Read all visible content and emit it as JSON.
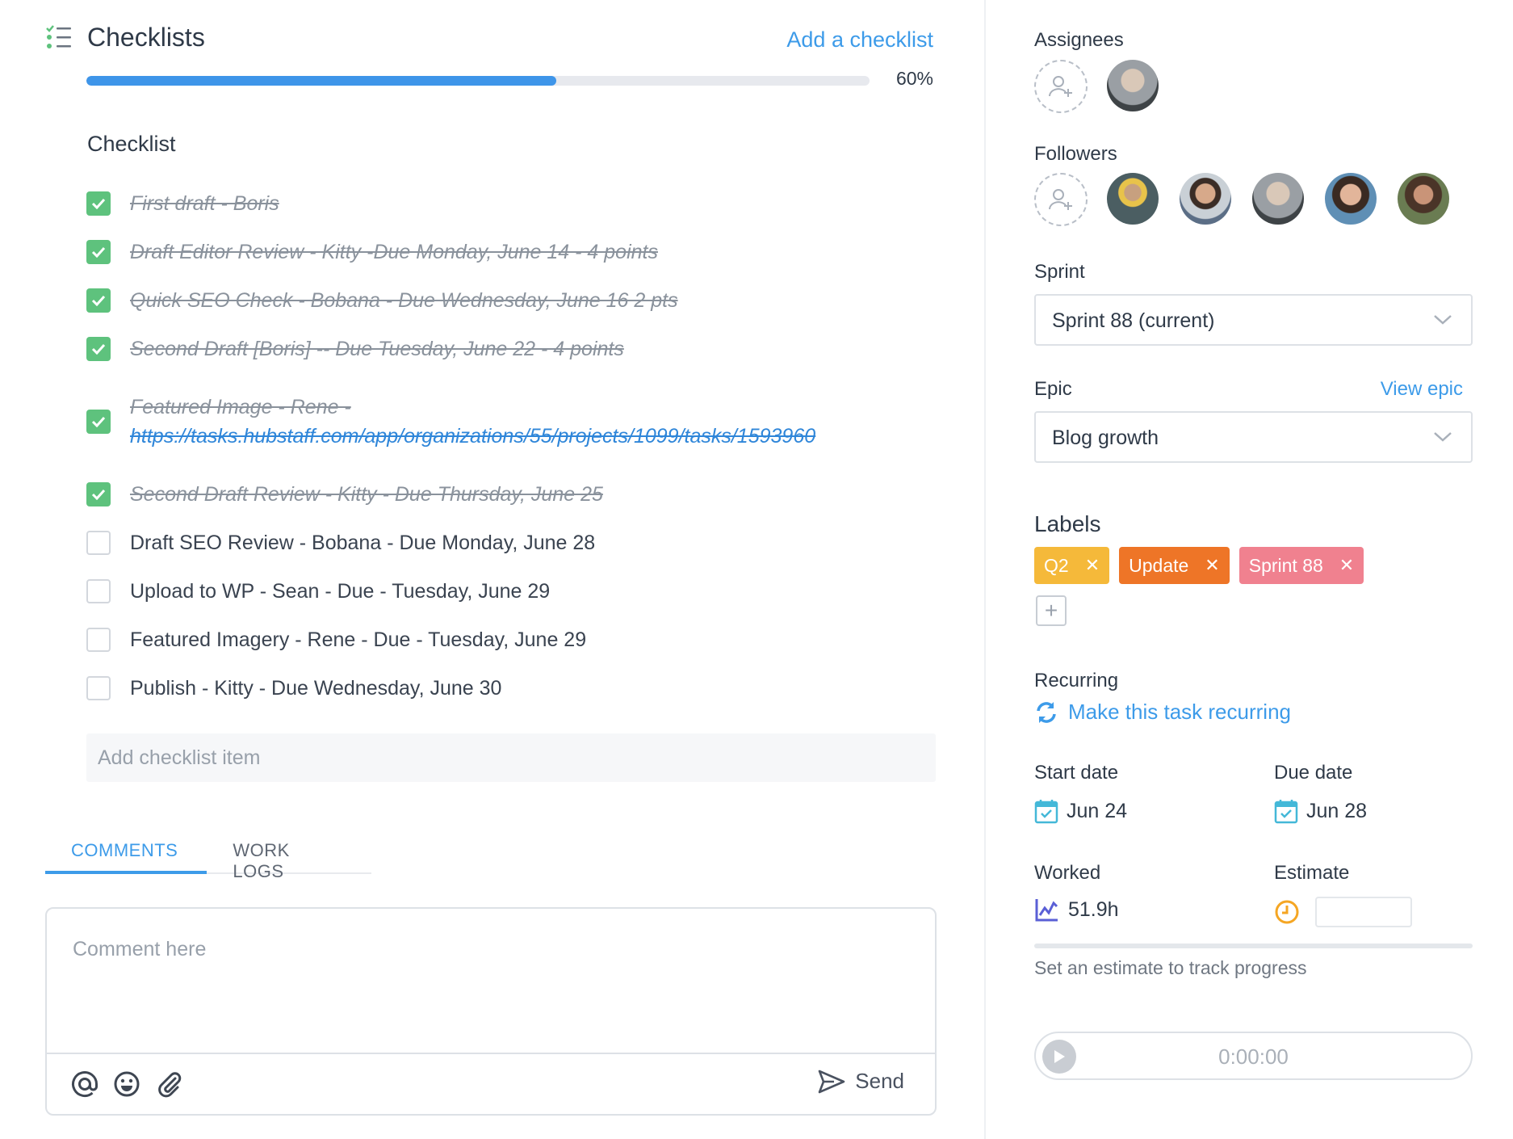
{
  "checklists": {
    "title": "Checklists",
    "add_label": "Add a checklist",
    "progress": 0.6,
    "progress_text": "60%",
    "checklist_title": "Checklist",
    "items": [
      {
        "text": "First draft - Boris",
        "done": true
      },
      {
        "text": "Draft Editor Review - Kitty -Due Monday, June 14 - 4 points",
        "done": true
      },
      {
        "text": "Quick SEO Check - Bobana - Due Wednesday, June 16 2 pts",
        "done": true
      },
      {
        "text": "Second Draft [Boris] -- Due Tuesday, June 22 - 4 points",
        "done": true
      },
      {
        "text": "Featured Image - Rene -",
        "link": "https://tasks.hubstaff.com/app/organizations/55/projects/1099/tasks/1593960",
        "done": true
      },
      {
        "text": "Second Draft Review - Kitty - Due Thursday, June 25",
        "done": true
      },
      {
        "text": "Draft SEO Review - Bobana - Due Monday, June 28",
        "done": false
      },
      {
        "text": "Upload to WP - Sean - Due - Tuesday, June 29",
        "done": false
      },
      {
        "text": "Featured Imagery - Rene - Due - Tuesday, June 29",
        "done": false
      },
      {
        "text": "Publish - Kitty - Due Wednesday, June 30",
        "done": false
      }
    ],
    "add_item_placeholder": "Add checklist item"
  },
  "tabs": [
    {
      "label": "COMMENTS",
      "active": true
    },
    {
      "label": "WORK LOGS",
      "active": false
    }
  ],
  "comment": {
    "placeholder": "Comment here",
    "send_label": "Send",
    "icons": [
      "at-icon",
      "emoji-icon",
      "paperclip-icon"
    ]
  },
  "sidebar": {
    "assignees_label": "Assignees",
    "followers_label": "Followers",
    "sprint_label": "Sprint",
    "sprint_value": "Sprint 88 (current)",
    "epic_label": "Epic",
    "view_epic": "View epic",
    "epic_value": "Blog growth",
    "labels_label": "Labels",
    "labels": [
      {
        "name": "Q2",
        "color": "#f5b93a"
      },
      {
        "name": "Update",
        "color": "#ee7527"
      },
      {
        "name": "Sprint 88",
        "color": "#f0818f"
      }
    ],
    "recurring_label": "Recurring",
    "recurring_link": "Make this task recurring",
    "start_date_label": "Start date",
    "start_date": "Jun 24",
    "due_date_label": "Due date",
    "due_date": "Jun 28",
    "worked_label": "Worked",
    "worked_value": "51.9h",
    "estimate_label": "Estimate",
    "estimate_hint": "Set an estimate to track progress",
    "timer": "0:00:00"
  },
  "colors": {
    "accent": "#3d9be9",
    "check_green": "#5ec27d"
  }
}
